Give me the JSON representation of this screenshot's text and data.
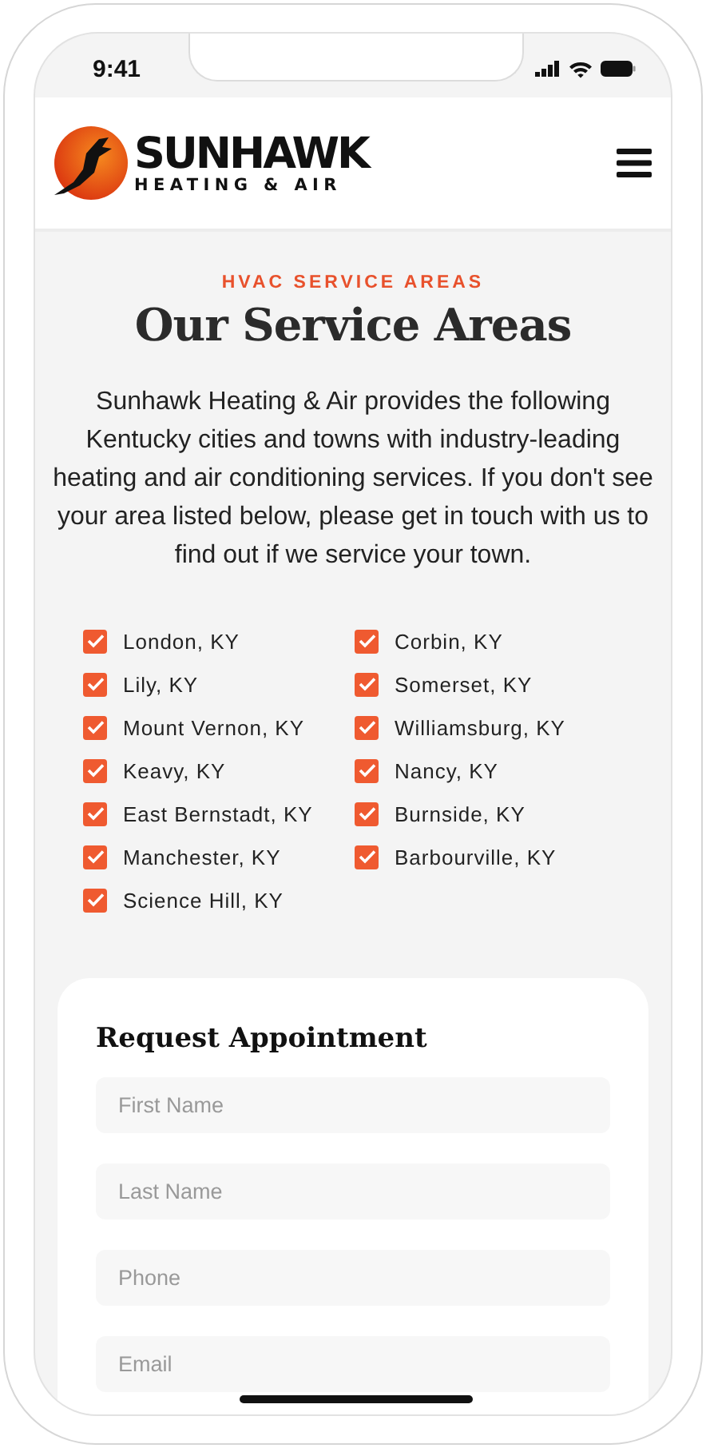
{
  "status_bar": {
    "time": "9:41"
  },
  "header": {
    "brand": "SUNHAWK",
    "tagline": "HEATING & AIR"
  },
  "section": {
    "eyebrow": "HVAC SERVICE AREAS",
    "title": "Our Service Areas",
    "intro": "Sunhawk Heating & Air provides the following Kentucky cities and towns with industry-leading heating and air conditioning services. If you don't see your area listed below, please get in touch with us to find out if we service your town."
  },
  "areas": [
    [
      {
        "label": "London, KY",
        "checked": true
      },
      {
        "label": "Lily, KY",
        "checked": true
      },
      {
        "label": "Mount Vernon, KY",
        "checked": true
      },
      {
        "label": "Keavy, KY",
        "checked": true
      },
      {
        "label": "East Bernstadt, KY",
        "checked": true
      },
      {
        "label": "Manchester, KY",
        "checked": true
      },
      {
        "label": "Science Hill, KY",
        "checked": true
      }
    ],
    [
      {
        "label": "Corbin, KY",
        "checked": true
      },
      {
        "label": "Somerset, KY",
        "checked": true
      },
      {
        "label": "Williamsburg, KY",
        "checked": true
      },
      {
        "label": "Nancy, KY",
        "checked": true
      },
      {
        "label": "Burnside, KY",
        "checked": true
      },
      {
        "label": "Barbourville, KY",
        "checked": true
      }
    ]
  ],
  "form": {
    "title": "Request Appointment",
    "fields": [
      {
        "placeholder": "First Name"
      },
      {
        "placeholder": "Last Name"
      },
      {
        "placeholder": "Phone"
      },
      {
        "placeholder": "Email"
      }
    ]
  }
}
